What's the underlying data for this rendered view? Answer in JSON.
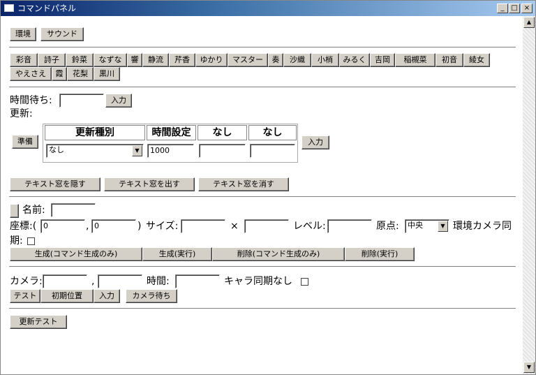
{
  "window": {
    "title": "コマンドパネル",
    "min": "_",
    "max": "□",
    "close": "×"
  },
  "top_buttons": [
    "環境",
    "サウンド"
  ],
  "characters": [
    "彩音",
    "詩子",
    "鈴菜",
    "なずな",
    "響",
    "静流",
    "芹香",
    "ゆかり",
    "マスター",
    "奏",
    "沙織",
    "小梢",
    "みるく",
    "吉岡",
    "稲槻菜",
    "初音",
    "綾女",
    "やえさえ",
    "霞",
    "花梨",
    "黒川"
  ],
  "wait": {
    "label": "時間待ち:",
    "value": "",
    "button": "入力"
  },
  "update": {
    "label": "更新:",
    "prepare": "準備",
    "headers": [
      "更新種別",
      "時間設定",
      "なし",
      "なし"
    ],
    "type_value": "なし",
    "time_value": "1000",
    "extra1": "",
    "extra2": "",
    "button": "入力"
  },
  "text_window": [
    "テキスト窓を隠す",
    "テキスト窓を出す",
    "テキスト窓を消す"
  ],
  "object": {
    "name_label": "名前:",
    "name_value": "",
    "coord_label": "座標:(",
    "x_value": "0",
    "comma": ",",
    "y_value": "0",
    "close_paren": ")",
    "size_label": "サイズ:",
    "size_w": "",
    "times": "×",
    "size_h": "",
    "level_label": "レベル:",
    "level_value": "",
    "origin_label": "原点:",
    "origin_value": "中央",
    "sync_label": "環境カメラ同",
    "sync_label2": "期:",
    "actions": [
      "生成(コマンド生成のみ)",
      "生成(実行)",
      "削除(コマンド生成のみ)",
      "削除(実行)"
    ]
  },
  "camera": {
    "label": "カメラ:",
    "x": "",
    "comma": ",",
    "y": "",
    "time_label": "時間:",
    "time_value": "",
    "chara_sync": "キャラ同期なし",
    "buttons": [
      "テスト",
      "初期位置",
      "入力",
      "カメラ待ち"
    ]
  },
  "update_test": "更新テスト"
}
